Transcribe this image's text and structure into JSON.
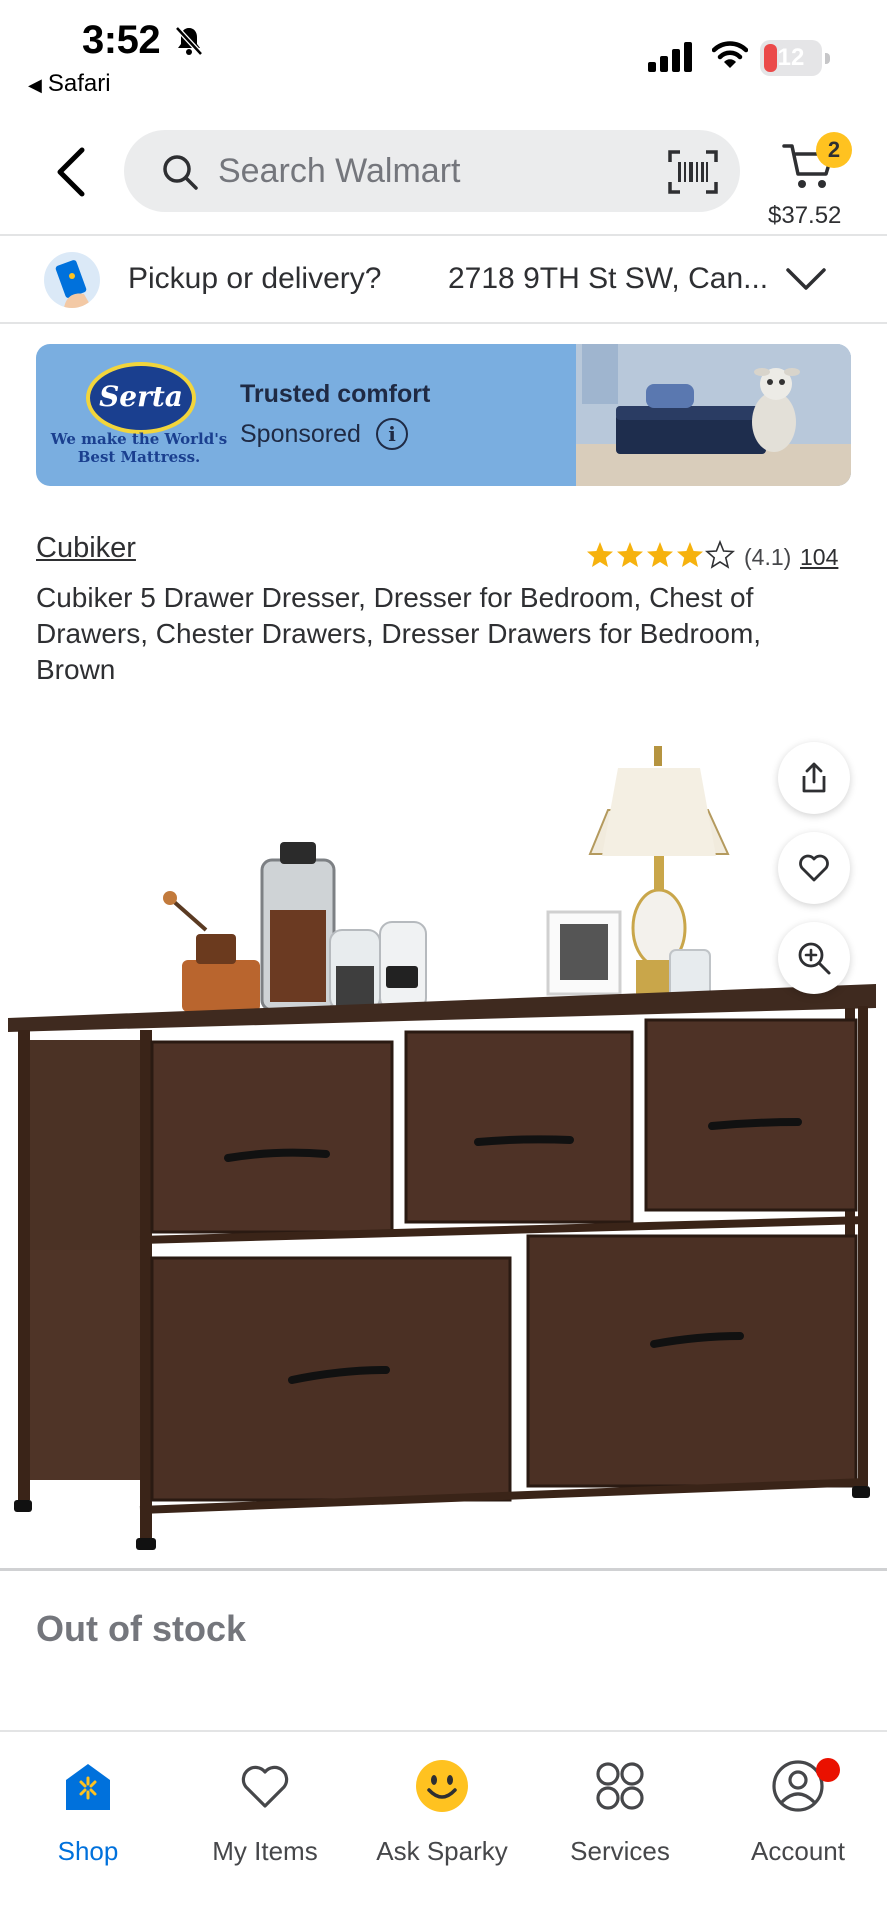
{
  "status_bar": {
    "time": "3:52",
    "back_app": "Safari",
    "battery": "12"
  },
  "header": {
    "search_placeholder": "Search Walmart",
    "cart_count": "2",
    "cart_total": "$37.52"
  },
  "pickup": {
    "label": "Pickup or delivery?",
    "address": "2718 9TH St SW, Can..."
  },
  "ad": {
    "brand": "Serta",
    "tagline": "We make the World's Best Mattress.",
    "title": "Trusted comfort",
    "sponsored": "Sponsored",
    "info_glyph": "i"
  },
  "product": {
    "brand": "Cubiker",
    "rating_value": "(4.1)",
    "rating_count": "104",
    "rating_stars": 4.1,
    "title": "Cubiker 5 Drawer Dresser, Dresser for Bedroom, Chest of Drawers, Chester Drawers, Dresser Drawers for Bedroom, Brown",
    "availability": "Out of stock"
  },
  "nav": {
    "items": [
      {
        "label": "Shop",
        "icon": "shop-icon",
        "active": true
      },
      {
        "label": "My Items",
        "icon": "heart-icon",
        "active": false
      },
      {
        "label": "Ask Sparky",
        "icon": "sparky-icon",
        "active": false
      },
      {
        "label": "Services",
        "icon": "services-icon",
        "active": false
      },
      {
        "label": "Account",
        "icon": "account-icon",
        "active": false
      }
    ]
  },
  "colors": {
    "brand_blue": "#0071dc",
    "cart_badge": "#ffc220",
    "star": "#f6b20e",
    "ad_background": "#7aaee0"
  }
}
